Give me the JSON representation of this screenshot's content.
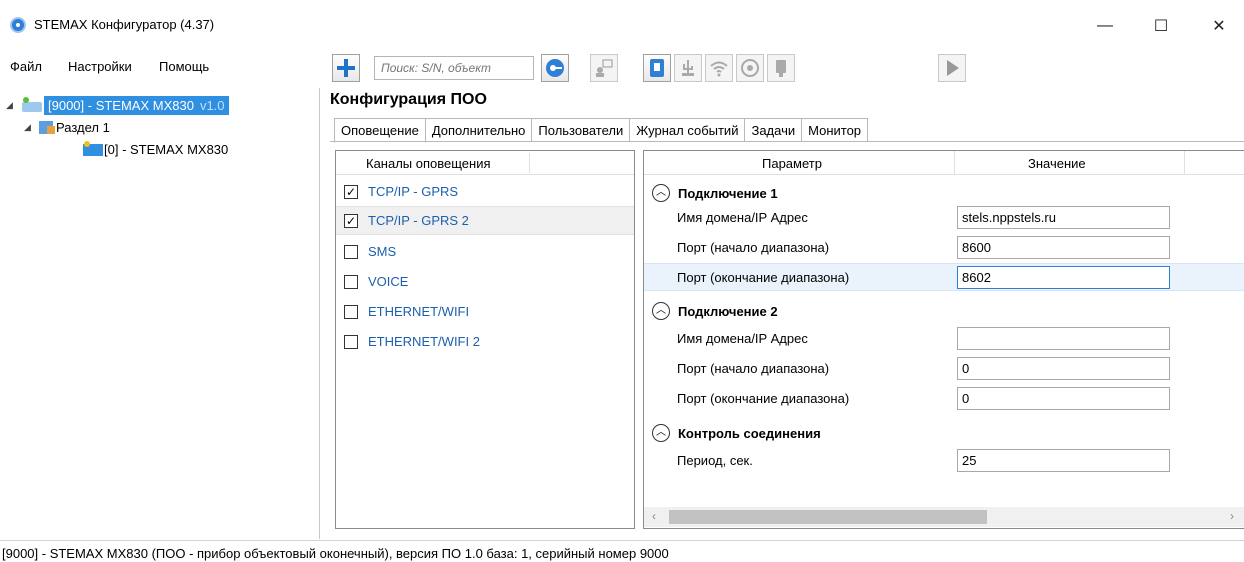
{
  "window": {
    "title": "STEMAX Конфигуратор (4.37)",
    "minimize": "—",
    "maximize": "☐",
    "close": "✕"
  },
  "menu": {
    "items": [
      "Файл",
      "Настройки",
      "Помощь"
    ]
  },
  "toolbar": {
    "search_placeholder": "Поиск: S/N, объект",
    "icons": [
      "add-icon",
      "search-key-icon",
      "user-device-icon",
      "usb-icon",
      "usb-alt-icon",
      "wifi-icon",
      "globe-icon",
      "modem-icon",
      "play-icon"
    ]
  },
  "tree": {
    "device_label": "[9000] - STEMAX MX830",
    "device_version": "v1.0",
    "section_label": "Раздел 1",
    "child_label": "[0] - STEMAX MX830"
  },
  "main": {
    "title": "Конфигурация ПОО",
    "tabs": [
      "Оповещение",
      "Дополнительно",
      "Пользователи",
      "Журнал событий",
      "Задачи",
      "Монитор"
    ],
    "active_tab": "Оповещение"
  },
  "channels": {
    "header": "Каналы оповещения",
    "items": [
      {
        "label": "TCP/IP - GPRS",
        "checked": true
      },
      {
        "label": "TCP/IP - GPRS 2",
        "checked": true
      },
      {
        "label": "SMS",
        "checked": false
      },
      {
        "label": "VOICE",
        "checked": false
      },
      {
        "label": "ETHERNET/WIFI",
        "checked": false
      },
      {
        "label": "ETHERNET/WIFI 2",
        "checked": false
      }
    ]
  },
  "params": {
    "header_param": "Параметр",
    "header_value": "Значение",
    "groups": [
      {
        "title": "Подключение 1",
        "rows": [
          {
            "name": "Имя домена/IP Адрес",
            "value": "stels.nppstels.ru"
          },
          {
            "name": "Порт (начало диапазона)",
            "value": "8600"
          },
          {
            "name": "Порт (окончание диапазона)",
            "value": "8602"
          }
        ]
      },
      {
        "title": "Подключение 2",
        "rows": [
          {
            "name": "Имя домена/IP Адрес",
            "value": ""
          },
          {
            "name": "Порт (начало диапазона)",
            "value": "0"
          },
          {
            "name": "Порт (окончание диапазона)",
            "value": "0"
          }
        ]
      },
      {
        "title": "Контроль соединения",
        "rows": [
          {
            "name": "Период, сек.",
            "value": "25"
          }
        ]
      }
    ]
  },
  "status": {
    "text": "[9000] - STEMAX MX830 (ПОО - прибор объектовый оконечный), версия ПО 1.0 база: 1, серийный номер 9000"
  },
  "colors": {
    "accent": "#2f8fe0",
    "link": "#1b5fad"
  }
}
